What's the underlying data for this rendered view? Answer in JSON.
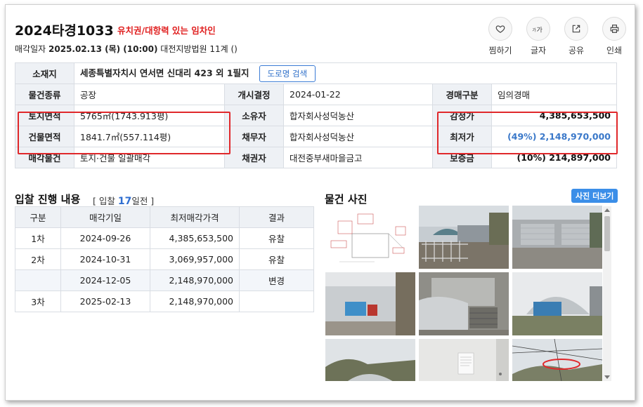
{
  "header": {
    "case_number": "2024타경1033",
    "case_tag": "유치권/대항력 있는 임차인",
    "sale_label": "매각일자",
    "sale_date": "2025.02.13 (목) (10:00)",
    "court": "대전지방법원 11계 ()"
  },
  "actions": [
    {
      "label": "찜하기",
      "icon": "heart-icon"
    },
    {
      "label": "글자",
      "icon": "font-size-icon"
    },
    {
      "label": "공유",
      "icon": "share-icon"
    },
    {
      "label": "인쇄",
      "icon": "print-icon"
    }
  ],
  "info": {
    "address_label": "소재지",
    "address": "세종특별자치시 연서면 신대리 423 외 1필지",
    "road_button": "도로명 검색",
    "type_label": "물건종류",
    "type": "공장",
    "start_label": "개시결정",
    "start_date": "2024-01-22",
    "auction_type_label": "경매구분",
    "auction_type": "임의경매",
    "land_label": "토지면적",
    "land_area": "5765㎡(1743.913평)",
    "owner_label": "소유자",
    "owner": "합자회사성덕농산",
    "appraisal_label": "감정가",
    "appraisal": "4,385,653,500",
    "building_label": "건물면적",
    "building_area": "1841.7㎡(557.114평)",
    "debtor_label": "채무자",
    "debtor": "합자회사성덕농산",
    "min_price_label": "최저가",
    "min_price": "(49%) 2,148,970,000",
    "sale_item_label": "매각물건",
    "sale_item": "토지·건물 일괄매각",
    "creditor_label": "채권자",
    "creditor": "대전중부새마을금고",
    "deposit_label": "보증금",
    "deposit": "(10%) 214,897,000"
  },
  "bidding": {
    "title": "입찰 진행 내용",
    "days_prefix": "[ 입찰",
    "days_value": "17",
    "days_suffix": "일전 ]",
    "columns": [
      "구분",
      "매각기일",
      "최저매각가격",
      "결과"
    ],
    "rows": [
      {
        "round": "1차",
        "date": "2024-09-26",
        "price": "4,385,653,500",
        "result": "유찰"
      },
      {
        "round": "2차",
        "date": "2024-10-31",
        "price": "3,069,957,000",
        "result": "유찰"
      },
      {
        "round": "",
        "date": "2024-12-05",
        "price": "2,148,970,000",
        "result": "변경"
      },
      {
        "round": "3차",
        "date": "2025-02-13",
        "price": "2,148,970,000",
        "result": ""
      }
    ]
  },
  "photos": {
    "title": "물건 사진",
    "more_button": "사진 더보기"
  },
  "colors": {
    "accent_red": "#e02020",
    "link_blue": "#2e6fc9",
    "header_bg": "#eef1f5"
  }
}
